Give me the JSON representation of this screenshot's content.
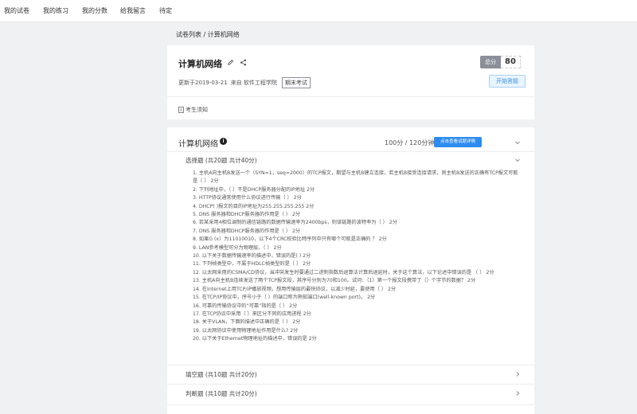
{
  "nav": [
    "我的试卷",
    "我的练习",
    "我的分数",
    "给我留言",
    "待定"
  ],
  "breadcrumb": "试卷列表 / 计算机网络",
  "paper": {
    "title": "计算机网络",
    "score_label": "总分",
    "score_value": "80",
    "updated": "更新于2019-03-21",
    "source": "来自 软件工程学院",
    "tag": "期末考试",
    "start_button": "开始答题",
    "notice": "考生须知"
  },
  "section": {
    "title": "计算机网络",
    "score_time": "100分 / 120分钟",
    "detail_button": "点击查看试题详情"
  },
  "groups": [
    {
      "label": "选择题 (共20题 共计40分)"
    },
    {
      "label": "填空题 (共10题 共计20分)"
    },
    {
      "label": "判断题 (共10题 共计20分)"
    }
  ],
  "questions": [
    "1. 主机A向主机B发送一个（SYN=1，seq=2000）的TCP报文，期望与主机B建立连接，若主机B接受连接请求，则主机B发送的正确有TCP报文可能是（ ） 2分",
    "2. 下列地址中，（ ）不是DHCP服务器分配的IP地址 2分",
    "3. HTTP协议通常使用什么协议进行传输（ ） 2分",
    "4. DHCP(  )报文的目的IP地址为255.255.255.255 2分",
    "5. DNS 服务器和DHCP服务器的作用是（ ） 2分",
    "6. 若某采用4相位调制的通信链路的数据传输速率为2400bps，则该链路的波特率为（ ） 2分",
    "7. DNS 服务器和DHCP服务器的作用是（ ） 2分",
    "8. 如果G (x）为11010010，以下4个CRC校验比特序列中只有哪个可能是正确的 ？ 2分",
    "9. LAN参考模型可分为物理层、（ ） 2分",
    "10. 以下关于数据传输速率的描述中，错误的是( ) 2分",
    "11. 下列帧类型中，不属于HDLC帧类型的是（ ） 2分",
    "12. 以太网采用的CSMA/CD协议，当冲突发生时要通过二进制指数后退算法计算后退延时，关于这个算法，以下论述中错误的是 （ ） 2分",
    "13. 主机A向主机B连续发送了两个TCP报文段，其序号分别为70和100。试问：（1）第一个报文段携带了（）个字节的数据？ 2分",
    "14. 在Internet上用TCP/IP播放视频，想用传输层的最快协议，以减少时延，要使用（ ） 2分",
    "15. 在TCP/IP协议中，序号小于（ ）的端口称为熟知端口(well-known port)。 2分",
    "16. 可靠的传输协议中的“可靠”指的是（ ） 2分",
    "17. 在TCP协议中采用（ ）来区分不同的应用进程 2分",
    "18. 关于VLAN，下面的描述中正确的是（ ） 2分",
    "19. 以太网协议中使用物理地址作用是什么? 2分",
    "20. 以下关于Ethernet物理地址的描述中，错误的是 2分"
  ],
  "colors": {
    "primary": "#2d8cf0",
    "score_label_bg": "#8a8f99",
    "page_bg": "#f0f1f3"
  },
  "icons": [
    "edit-icon",
    "share-icon",
    "document-icon",
    "info-icon",
    "chevron-down-icon",
    "chevron-right-icon"
  ]
}
